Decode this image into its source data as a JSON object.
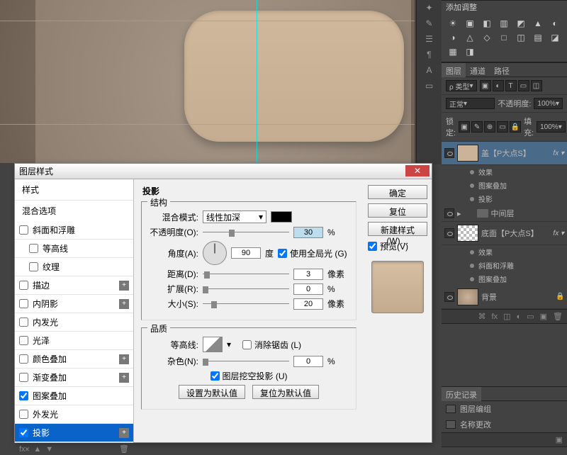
{
  "canvas": {},
  "dialog": {
    "title": "图层样式",
    "close_glyph": "✕",
    "styles_header": "样式",
    "blend_header": "混合选项",
    "styles": [
      {
        "label": "斜面和浮雕",
        "checked": false
      },
      {
        "label": "等高线",
        "checked": false,
        "indent": true
      },
      {
        "label": "纹理",
        "checked": false,
        "indent": true
      },
      {
        "label": "描边",
        "checked": false,
        "plus": true
      },
      {
        "label": "内阴影",
        "checked": false,
        "plus": true
      },
      {
        "label": "内发光",
        "checked": false
      },
      {
        "label": "光泽",
        "checked": false
      },
      {
        "label": "颜色叠加",
        "checked": false,
        "plus": true
      },
      {
        "label": "渐变叠加",
        "checked": false,
        "plus": true
      },
      {
        "label": "图案叠加",
        "checked": true
      },
      {
        "label": "外发光",
        "checked": false
      },
      {
        "label": "投影",
        "checked": true,
        "plus": true,
        "selected": true
      }
    ],
    "footer": {
      "fx": "fx᰽",
      "up": "▲",
      "down": "▼",
      "trash": "🗑"
    },
    "section_title": "投影",
    "structure_group_label": "结构",
    "blend_mode_label": "混合模式:",
    "blend_mode_value": "线性加深",
    "opacity_label": "不透明度(O):",
    "opacity_value": "30",
    "opacity_unit": "%",
    "angle_label": "角度(A):",
    "angle_value": "90",
    "angle_unit": "度",
    "use_global_light": "使用全局光 (G)",
    "distance_label": "距离(D):",
    "distance_value": "3",
    "distance_unit": "像素",
    "spread_label": "扩展(R):",
    "spread_value": "0",
    "spread_unit": "%",
    "size_label": "大小(S):",
    "size_value": "20",
    "size_unit": "像素",
    "quality_group_label": "品质",
    "contour_label": "等高线:",
    "antialias_label": "消除锯齿 (L)",
    "noise_label": "杂色(N):",
    "noise_value": "0",
    "noise_unit": "%",
    "knockout_label": "图层挖空投影 (U)",
    "make_default": "设置为默认值",
    "reset_default": "复位为默认值",
    "right": {
      "ok": "确定",
      "cancel": "复位",
      "new_style": "新建样式(W)…",
      "preview_label": "预览(V)"
    }
  },
  "right": {
    "adjustments_title": "添加调整",
    "adj_icons": [
      "☀",
      "▣",
      "◧",
      "▥",
      "◩",
      "▲",
      "◐",
      "◑",
      "△",
      "◇",
      "□",
      "◫",
      "▤",
      "◪",
      "▦",
      "◨"
    ],
    "layerpanel": {
      "tabs": [
        "图层",
        "通道",
        "路径"
      ],
      "kind_label": "ρ 类型",
      "kind_icons": [
        "▣",
        "◐",
        "T",
        "▭",
        "◫"
      ],
      "blend": "正常",
      "opacity_label": "不透明度:",
      "opacity_value": "100%",
      "lock_label": "锁定:",
      "lock_icons": [
        "▣",
        "✎",
        "⊕",
        "▭",
        "🔒"
      ],
      "fill_label": "填充:",
      "fill_value": "100%"
    },
    "layers": [
      {
        "type": "layer",
        "name": "盖【P大点S】",
        "fx": true,
        "sel": true,
        "thumb": "tan"
      },
      {
        "type": "sub",
        "name": "效果"
      },
      {
        "type": "sub",
        "name": "图案叠加"
      },
      {
        "type": "sub",
        "name": "投影"
      },
      {
        "type": "folder",
        "name": "中间层"
      },
      {
        "type": "layer",
        "name": "底面【P大点S】",
        "fx": true,
        "thumb": "chk"
      },
      {
        "type": "sub",
        "name": "效果"
      },
      {
        "type": "sub",
        "name": "斜面和浮雕"
      },
      {
        "type": "sub",
        "name": "图案叠加"
      },
      {
        "type": "layer",
        "name": "背景",
        "locked": true,
        "thumb": "grad"
      }
    ],
    "history_title": "历史记录",
    "history": [
      "图层编组",
      "名称更改"
    ]
  }
}
